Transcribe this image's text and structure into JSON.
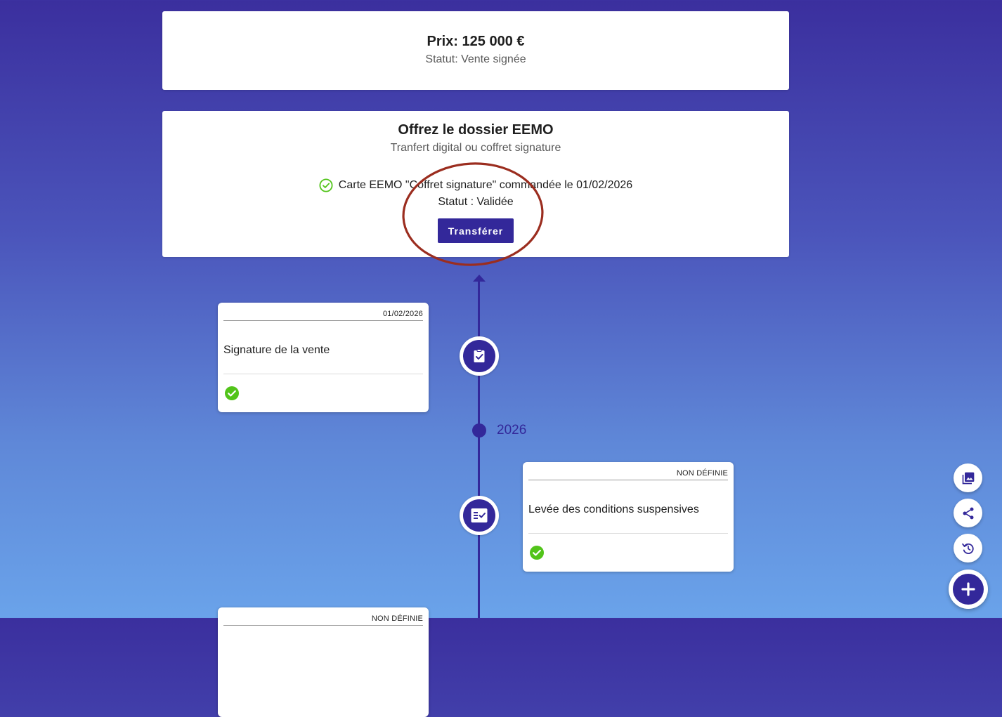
{
  "price_card": {
    "title": "Prix: 125 000 €",
    "status": "Statut: Vente signée"
  },
  "offer_card": {
    "title": "Offrez le dossier EEMO",
    "subtitle": "Tranfert digital ou coffret signature",
    "order_line": "Carte EEMO \"Coffret signature\" commandée le 01/02/2026",
    "status": "Statut : Validée",
    "transfer_label": "Transférer"
  },
  "timeline": {
    "year": "2026",
    "events": [
      {
        "date": "01/02/2026",
        "title": "Signature de la vente",
        "icon": "clipboard-check-icon",
        "done": true
      },
      {
        "date": "NON DÉFINIE",
        "title": "Levée des conditions suspensives",
        "icon": "fact-check-icon",
        "done": true
      },
      {
        "date": "NON DÉFINIE",
        "title": "",
        "icon": "",
        "done": false
      }
    ]
  },
  "fabs": {
    "items": [
      "photo-library-icon",
      "share-icon",
      "history-icon",
      "add-icon"
    ]
  },
  "colors": {
    "primary": "#33289a",
    "success": "#52c41a",
    "annotation": "#9b2d1f"
  }
}
